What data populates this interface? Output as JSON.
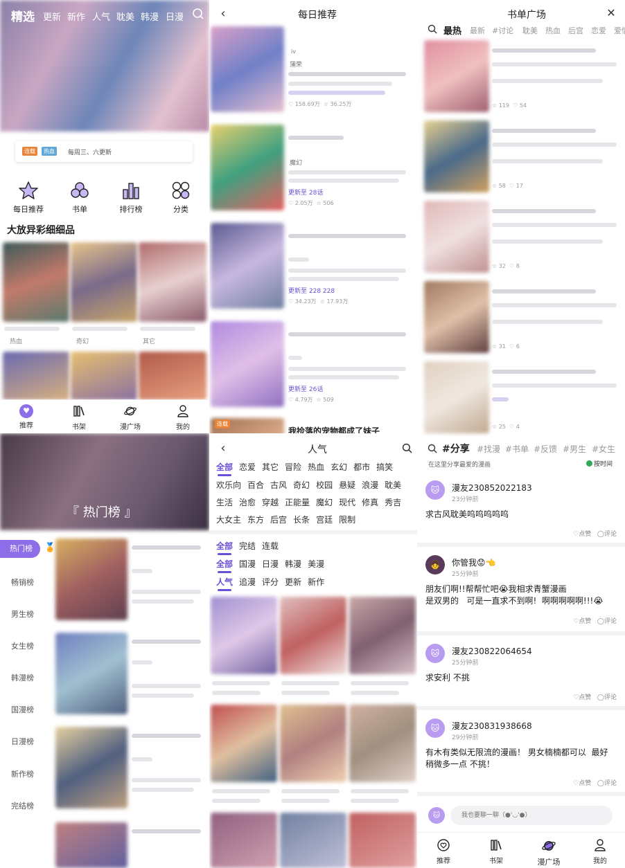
{
  "colors": {
    "accent": "#6b4fd8",
    "tag_orange": "#e8843a",
    "tag_blue": "#5fa8d8"
  },
  "home": {
    "tabs": [
      "精选",
      "更新",
      "新作",
      "人气",
      "耽美",
      "韩漫",
      "日漫"
    ],
    "banner_tags": [
      "连载",
      "热血"
    ],
    "banner_schedule": "每周三、六更新",
    "quick_nav": [
      {
        "label": "每日推荐",
        "icon": "star-icon"
      },
      {
        "label": "书单",
        "icon": "circles-icon"
      },
      {
        "label": "排行榜",
        "icon": "bar-chart-icon"
      },
      {
        "label": "分类",
        "icon": "grid-icon"
      }
    ],
    "section_title": "大放异彩细细品",
    "genre_labels": [
      "热血",
      "奇幻",
      "其它"
    ],
    "bottom_nav": [
      "推荐",
      "书架",
      "漫广场",
      "我的"
    ]
  },
  "rank": {
    "banner_title": "『 热门榜 』",
    "items": [
      "热门榜",
      "畅销榜",
      "男生榜",
      "女生榜",
      "韩漫榜",
      "国漫榜",
      "日漫榜",
      "新作榜",
      "完结榜"
    ]
  },
  "daily": {
    "title": "每日推荐",
    "entries": [
      {
        "meta1": "iv",
        "meta2": "蒲荣",
        "update": "",
        "likes": "158.69万",
        "stars": "36.25万"
      },
      {
        "meta1": "",
        "meta2": "魔幻",
        "update": "更新至 28话",
        "likes": "2.05万",
        "stars": "506"
      },
      {
        "meta1": "",
        "meta2": "",
        "update": "更新至 228 228",
        "likes": "34.23万",
        "stars": "17.93万"
      },
      {
        "meta1": "",
        "meta2": "",
        "update": "更新至 26话",
        "likes": "4.79万",
        "stars": "509"
      }
    ],
    "last_tag": "连载",
    "last_title": "我捡落的宠物都成了妹子"
  },
  "popular": {
    "title": "人气",
    "genres": [
      "全部",
      "恋爱",
      "其它",
      "冒险",
      "热血",
      "玄幻",
      "都市",
      "搞笑",
      "欢乐向",
      "百合",
      "古风",
      "奇幻",
      "校园",
      "悬疑",
      "浪漫",
      "耽美",
      "生活",
      "治愈",
      "穿越",
      "正能量",
      "魔幻",
      "现代",
      "修真",
      "秀吉",
      "大女主",
      "东方",
      "后宫",
      "长条",
      "宫廷",
      "限制"
    ],
    "status": [
      "全部",
      "完结",
      "连载"
    ],
    "region": [
      "全部",
      "国漫",
      "日漫",
      "韩漫",
      "美漫"
    ],
    "sort": [
      "人气",
      "追漫",
      "评分",
      "更新",
      "新作"
    ]
  },
  "booklist": {
    "title": "书单广场",
    "tabs": [
      "最热",
      "最新",
      "#讨论",
      "耽美",
      "热血",
      "后宫",
      "恋爱",
      "爱情"
    ],
    "stats": [
      [
        "119",
        "54"
      ],
      [
        "58",
        "17"
      ],
      [
        "32",
        "8"
      ],
      [
        "31",
        "6"
      ],
      [
        "25",
        "4"
      ]
    ]
  },
  "forum": {
    "tabs": [
      "#分享",
      "#找漫",
      "#书单",
      "#反馈",
      "#男生",
      "#女生"
    ],
    "subtitle": "在这里分享最爱的漫画",
    "sort_label": "按时间",
    "like_label": "点赞",
    "comment_label": "评论",
    "posts": [
      {
        "user": "漫友230852022183",
        "time": "23分钟前",
        "content": "求古风耽美呜呜呜呜呜"
      },
      {
        "user": "你管我😟👈",
        "time": "25分钟前",
        "content": "朋友们啊!!帮帮忙吧😭我相求青蟹漫画\n是双男的   可是一直求不到啊!  啊啊啊啊啊!!!😭"
      },
      {
        "user": "漫友230822064654",
        "time": "25分钟前",
        "content": "求安利 不挑"
      },
      {
        "user": "漫友230831938668",
        "time": "29分钟前",
        "content": "有木有类似无限流的漫画！ 男女楠楠都可以  最好\n稍微多一点 不挑！"
      }
    ],
    "input_placeholder": "我也要聊一聊（●'◡'●）",
    "bottom_nav": [
      "推荐",
      "书架",
      "漫广场",
      "我的"
    ]
  }
}
